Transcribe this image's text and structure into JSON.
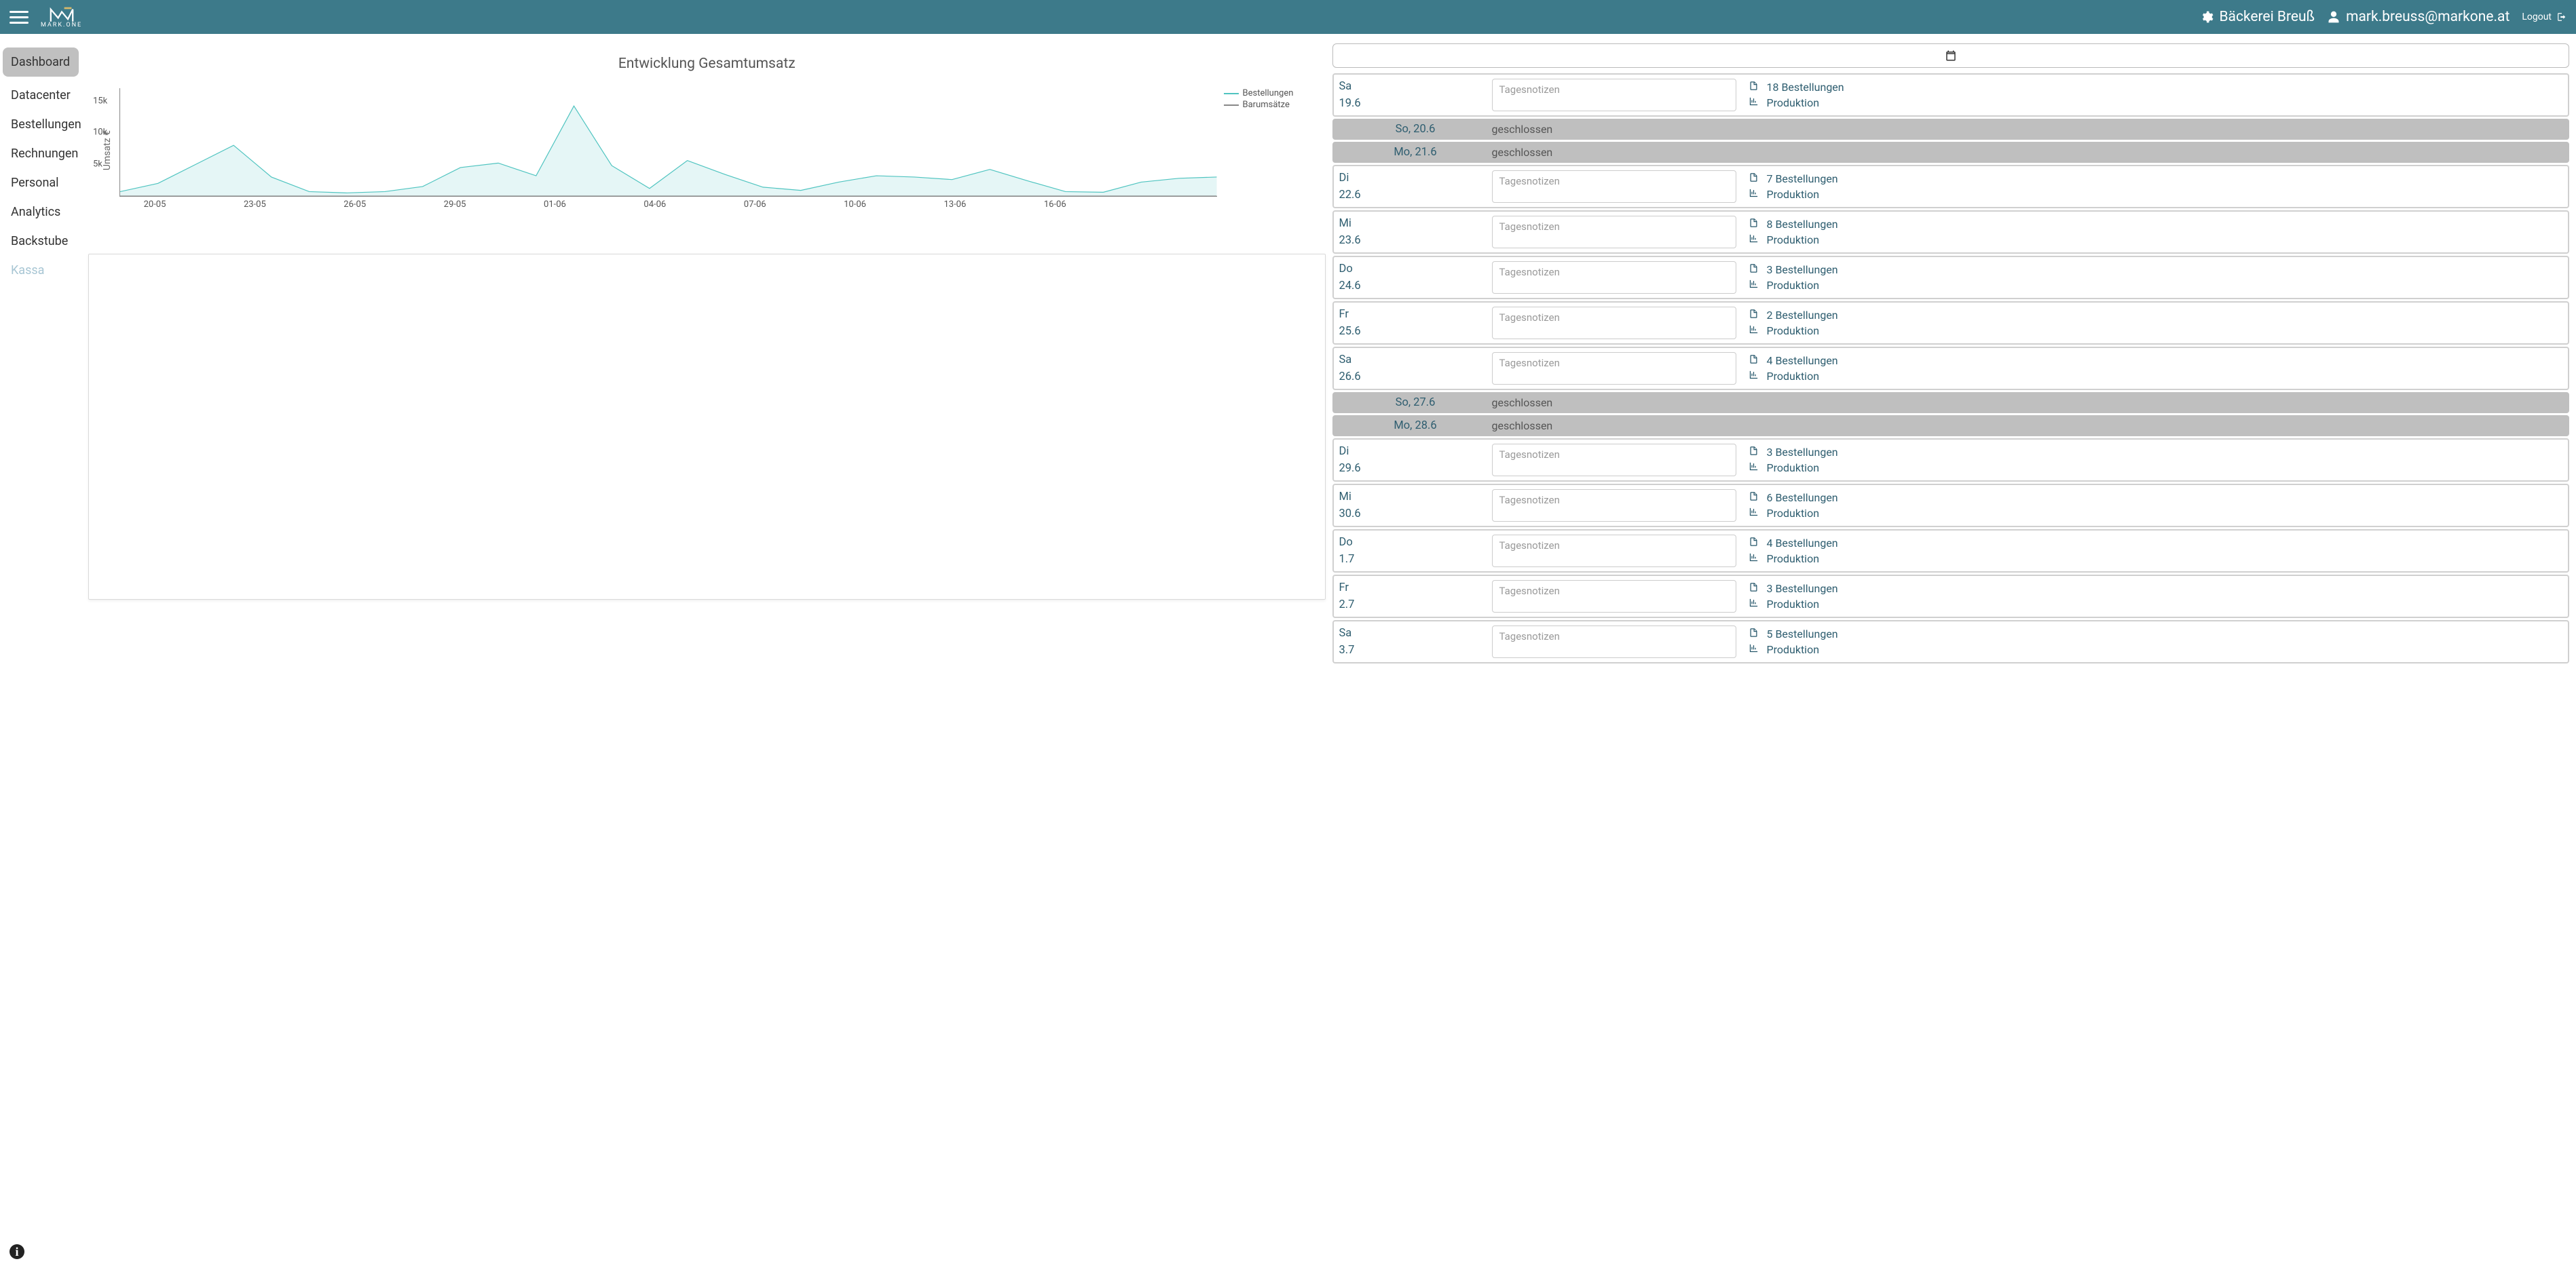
{
  "topbar": {
    "brand_text": "MARK.ONE",
    "company": "Bäckerei Breuß",
    "user": "mark.breuss@markone.at",
    "logout": "Logout"
  },
  "sidebar": {
    "items": [
      {
        "label": "Dashboard",
        "active": true
      },
      {
        "label": "Datacenter",
        "active": false
      },
      {
        "label": "Bestellungen",
        "active": false
      },
      {
        "label": "Rechnungen",
        "active": false
      },
      {
        "label": "Personal",
        "active": false
      },
      {
        "label": "Analytics",
        "active": false
      },
      {
        "label": "Backstube",
        "active": false
      },
      {
        "label": "Kassa",
        "active": false,
        "muted": true
      }
    ]
  },
  "chart_data": {
    "type": "line",
    "title": "Entwicklung Gesamtumsatz",
    "ylabel": "Umsatz €",
    "xlabel": "",
    "ylim": [
      0,
      17000
    ],
    "yticks": [
      {
        "v": 5000,
        "label": "5k"
      },
      {
        "v": 10000,
        "label": "10k"
      },
      {
        "v": 15000,
        "label": "15k"
      }
    ],
    "x": [
      "20-05",
      "21-05",
      "22-05",
      "23-05",
      "24-05",
      "25-05",
      "26-05",
      "27-05",
      "28-05",
      "29-05",
      "30-05",
      "31-05",
      "01-06",
      "02-06",
      "03-06",
      "04-06",
      "05-06",
      "06-06",
      "07-06",
      "08-06",
      "09-06",
      "10-06",
      "11-06",
      "12-06",
      "13-06",
      "14-06",
      "15-06",
      "16-06",
      "17-06",
      "18-06"
    ],
    "x_tick_labels": [
      "20-05",
      "23-05",
      "26-05",
      "29-05",
      "01-06",
      "04-06",
      "07-06",
      "10-06",
      "13-06",
      "16-06"
    ],
    "series": [
      {
        "name": "Bestellungen",
        "color": "#4fc4c0",
        "values": [
          700,
          2000,
          5000,
          8000,
          3000,
          700,
          500,
          700,
          1500,
          4500,
          5200,
          3200,
          14200,
          4800,
          1200,
          5600,
          3400,
          1400,
          900,
          2200,
          3200,
          3000,
          2600,
          4200,
          2400,
          700,
          600,
          2200,
          2800,
          3000
        ]
      },
      {
        "name": "Barumsätze",
        "color": "#888888",
        "values": [
          0,
          0,
          0,
          0,
          0,
          0,
          0,
          0,
          0,
          0,
          0,
          0,
          0,
          0,
          0,
          0,
          0,
          0,
          0,
          0,
          0,
          0,
          0,
          0,
          0,
          0,
          0,
          0,
          0,
          0
        ]
      }
    ]
  },
  "calendar": {
    "notes_placeholder": "Tagesnotizen",
    "closed_label": "geschlossen",
    "production_label": "Produktion",
    "days": [
      {
        "weekday": "Sa",
        "date": "19.6",
        "closed": false,
        "orders_text": "18 Bestellungen"
      },
      {
        "weekday": "So",
        "date": "20.6",
        "closed": true,
        "combined": "So, 20.6"
      },
      {
        "weekday": "Mo",
        "date": "21.6",
        "closed": true,
        "combined": "Mo, 21.6"
      },
      {
        "weekday": "Di",
        "date": "22.6",
        "closed": false,
        "orders_text": "7 Bestellungen"
      },
      {
        "weekday": "Mi",
        "date": "23.6",
        "closed": false,
        "orders_text": "8 Bestellungen"
      },
      {
        "weekday": "Do",
        "date": "24.6",
        "closed": false,
        "orders_text": "3 Bestellungen"
      },
      {
        "weekday": "Fr",
        "date": "25.6",
        "closed": false,
        "orders_text": "2 Bestellungen"
      },
      {
        "weekday": "Sa",
        "date": "26.6",
        "closed": false,
        "orders_text": "4 Bestellungen"
      },
      {
        "weekday": "So",
        "date": "27.6",
        "closed": true,
        "combined": "So, 27.6"
      },
      {
        "weekday": "Mo",
        "date": "28.6",
        "closed": true,
        "combined": "Mo, 28.6"
      },
      {
        "weekday": "Di",
        "date": "29.6",
        "closed": false,
        "orders_text": "3 Bestellungen"
      },
      {
        "weekday": "Mi",
        "date": "30.6",
        "closed": false,
        "orders_text": "6 Bestellungen"
      },
      {
        "weekday": "Do",
        "date": "1.7",
        "closed": false,
        "orders_text": "4 Bestellungen"
      },
      {
        "weekday": "Fr",
        "date": "2.7",
        "closed": false,
        "orders_text": "3 Bestellungen"
      },
      {
        "weekday": "Sa",
        "date": "3.7",
        "closed": false,
        "orders_text": "5 Bestellungen"
      }
    ]
  }
}
